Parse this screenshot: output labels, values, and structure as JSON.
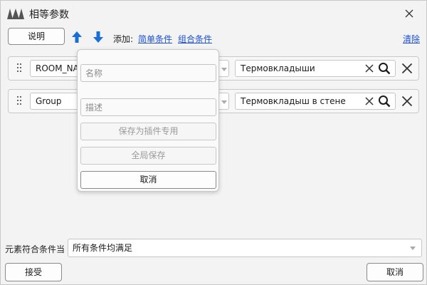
{
  "window": {
    "title": "相等参数"
  },
  "toolbar": {
    "explain_label": "说明",
    "add_label": "添加:",
    "simple_condition": "简单条件",
    "compound_condition": "组合条件",
    "clear_label": "清除"
  },
  "rows": [
    {
      "param": "ROOM_NA",
      "value": "Термовкладыши"
    },
    {
      "param": "Group",
      "value": "Термовкладыш в стене"
    }
  ],
  "popup": {
    "name_placeholder": "名称",
    "desc_placeholder": "描述",
    "save_plugin": "保存为插件专用",
    "save_global": "全局保存",
    "cancel": "取消"
  },
  "footer": {
    "condition_label": "元素符合条件当",
    "condition_value": "所有条件均满足",
    "accept": "接受",
    "cancel": "取消"
  },
  "colors": {
    "accent_blue": "#1a6fd4",
    "link": "#1a4fd6"
  },
  "icons": [
    "app-logo-icon",
    "close-icon",
    "arrow-up-icon",
    "arrow-down-icon",
    "grip-icon",
    "clear-x-icon",
    "search-icon",
    "remove-row-icon",
    "chevron-down-icon"
  ]
}
